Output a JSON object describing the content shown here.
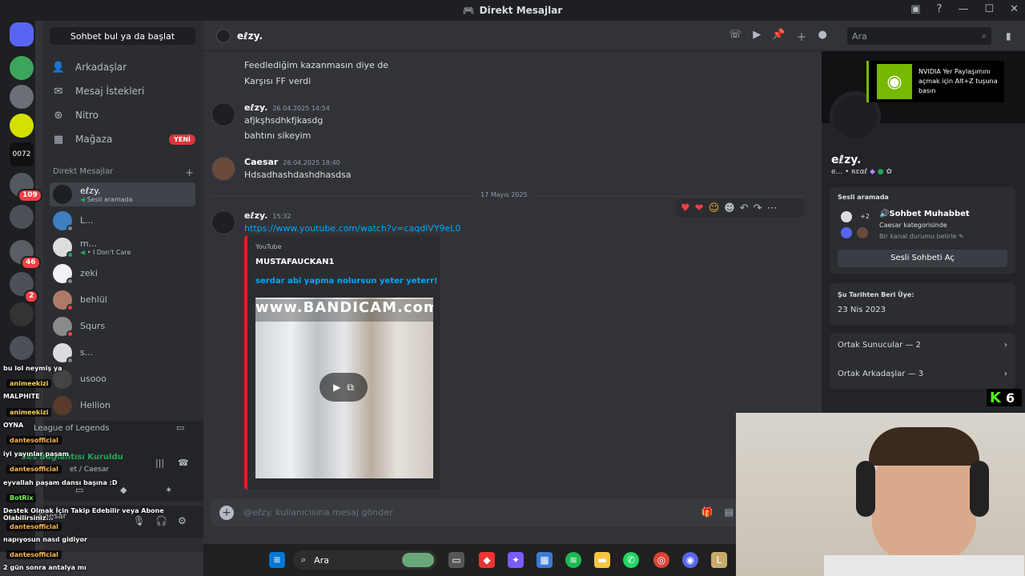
{
  "window": {
    "title": "Direkt Mesajlar"
  },
  "guild_badges": [
    "109",
    "46",
    "2"
  ],
  "guild_label": "0072",
  "dm_sidebar": {
    "search_label": "Sohbet bul ya da başlat",
    "nav": [
      {
        "label": "Arkadaşlar",
        "icon": "friends-icon"
      },
      {
        "label": "Mesaj İstekleri",
        "icon": "mail-icon"
      },
      {
        "label": "Nitro",
        "icon": "nitro-icon"
      },
      {
        "label": "Mağaza",
        "icon": "store-icon",
        "badge": "YENİ"
      }
    ],
    "dm_header": "Direkt Mesajlar",
    "dm_add": "+",
    "dms": [
      {
        "name": "eℓzy.",
        "sub": "Sesli aramada",
        "active": true
      },
      {
        "name": "L...",
        "sub": ""
      },
      {
        "name": "m...",
        "sub": "• I Don't Care"
      },
      {
        "name": "zeki",
        "sub": ""
      },
      {
        "name": "behlül",
        "sub": ""
      },
      {
        "name": "Squrs",
        "sub": ""
      },
      {
        "name": "s...",
        "sub": ""
      },
      {
        "name": "usooo",
        "sub": ""
      },
      {
        "name": "Hellion",
        "sub": ""
      }
    ],
    "voice_game": "League of Legends",
    "voice_status": "Ses Bağlantısı Kuruldu",
    "voice_channel": "et / Caesar",
    "user_name": "Caesar"
  },
  "chat_header": {
    "name": "eℓzy.",
    "search_placeholder": "Ara"
  },
  "messages": {
    "top_lines": [
      "Feedlediğim kazanmasın diye de",
      "Karşısı FF verdi"
    ],
    "m1": {
      "author": "eℓzy.",
      "time": "26.04.2025 14:54",
      "lines": [
        "afjkşhsdhkfjkasdg",
        "bahtını sikeyim"
      ]
    },
    "m2": {
      "author": "Caesar",
      "time": "26.04.2025 18:40",
      "lines": [
        "Hdsadhashdashdhasdsa"
      ]
    },
    "date_divider": "17 Mayıs 2025",
    "m3": {
      "author": "eℓzy.",
      "time": "15:32",
      "link": "https://www.youtube.com/watch?v=caqdlVY9eL0"
    },
    "embed": {
      "source": "YouTube",
      "author": "MUSTAFAUCKAN1",
      "title": "serdar abi yapma nolursun yeter yeterr!",
      "watermark": "www.BANDICAM.com"
    }
  },
  "input": {
    "placeholder": "@eℓzy. kullanıcısına mesaj gönder"
  },
  "profile": {
    "name": "eℓzy.",
    "tag": "e... • ʀɛαℓ",
    "voice_title": "Sesli aramada",
    "voice_count": "+2",
    "voice_channel": "🔊Sohbet Muhabbet",
    "voice_category": "Caesar kategorisinde",
    "voice_status": "Bir kanal durumu belirle",
    "voice_button": "Sesli Sohbeti Aç",
    "member_since_label": "Şu Tarihten Beri Üye:",
    "member_since": "23 Nis 2023",
    "mutual_servers": "Ortak Sunucular — 2",
    "mutual_friends": "Ortak Arkadaşlar — 3"
  },
  "nvidia": {
    "text": "NVIDIA Yer Paylaşımını açmak için Alt+Z tuşuna basın"
  },
  "kick": {
    "count": "6"
  },
  "stream_chat": [
    {
      "text": "bu lol neymiş ya",
      "user": "",
      "color": "#ffffff"
    },
    {
      "text": "",
      "user": "animeekizi",
      "color": "#ffd34d"
    },
    {
      "text": "MALPHITE",
      "user": "",
      "color": "#ffffff"
    },
    {
      "text": "",
      "user": "animeekizi",
      "color": "#ffd34d"
    },
    {
      "text": "OYNA",
      "user": "",
      "color": "#ffffff"
    },
    {
      "text": "",
      "user": "dantesofficial",
      "color": "#ffb74d"
    },
    {
      "text": "iyi yayınlar paşam",
      "user": "",
      "color": "#ffffff"
    },
    {
      "text": "",
      "user": "dantesofficial",
      "color": "#ffb74d"
    },
    {
      "text": "eyvallah paşam dansı başına :D",
      "user": "",
      "color": "#ffffff"
    },
    {
      "text": "",
      "user": "BotRix",
      "color": "#6cf542"
    },
    {
      "text": "Destek Olmak İçin Takip Edebilir veya Abone Olabilirsiniz...",
      "user": "",
      "color": "#ffffff"
    },
    {
      "text": "",
      "user": "dantesofficial",
      "color": "#ffb74d"
    },
    {
      "text": "napıyosun nasıl gidiyor",
      "user": "",
      "color": "#ffffff"
    },
    {
      "text": "",
      "user": "dantesofficial",
      "color": "#ffb74d"
    },
    {
      "text": "2 gün sonra antalya mı",
      "user": "",
      "color": "#ffffff"
    }
  ],
  "taskbar": {
    "search": "Ara"
  }
}
